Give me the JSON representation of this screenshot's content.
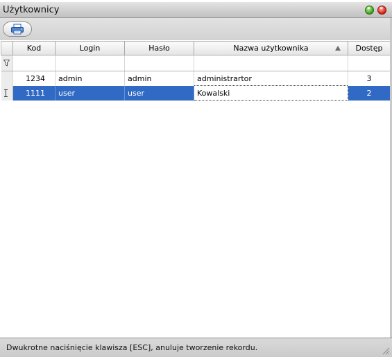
{
  "window": {
    "title": "Użytkownicy"
  },
  "toolbar": {
    "print_icon": "printer-icon"
  },
  "grid": {
    "columns": [
      {
        "key": "kod",
        "label": "Kod"
      },
      {
        "key": "login",
        "label": "Login"
      },
      {
        "key": "haslo",
        "label": "Hasło"
      },
      {
        "key": "nazwa",
        "label": "Nazwa użytkownika"
      },
      {
        "key": "dostep",
        "label": "Dostęp"
      }
    ],
    "sorted_column": "nazwa",
    "sort_direction": "ascending",
    "rows": [
      {
        "kod": "1234",
        "login": "admin",
        "haslo": "admin",
        "nazwa": "administrartor",
        "dostep": "3"
      },
      {
        "kod": "1111",
        "login": "user",
        "haslo": "user",
        "nazwa": "Kowalski",
        "dostep": "2"
      }
    ],
    "selected_row_index": 1,
    "selection_color": "#316ac5"
  },
  "status": {
    "message": "Dwukrotne naciśnięcie klawisza [ESC], anuluje tworzenie rekordu."
  }
}
